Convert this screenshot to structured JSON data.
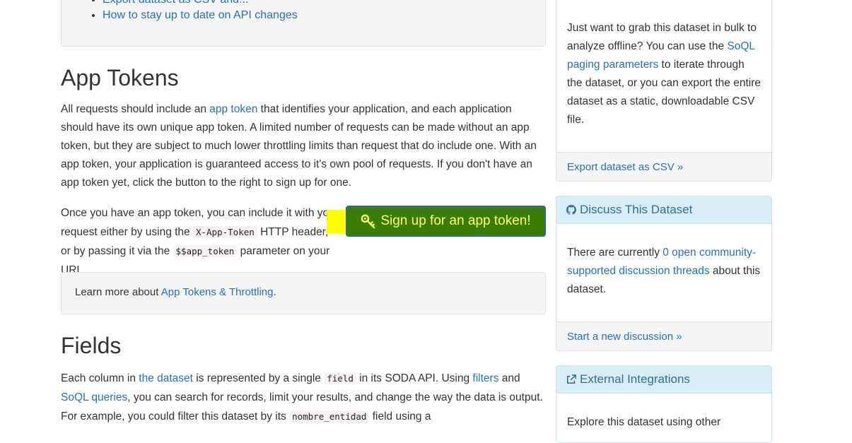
{
  "top_list": {
    "partial_item": "Export dataset as CSV and...",
    "item": "How to stay up to date on API changes"
  },
  "app_tokens": {
    "heading": "App Tokens",
    "p1": {
      "pre": "All requests should include an ",
      "link": "app token",
      "post": " that identifies your application, and each application should have its own unique app token. A limited number of requests can be made without an app token, but they are subject to much lower throttling limits than request that do include one. With an app token, your application is guaranteed access to it's own pool of requests. If you don't have an app token yet, click the button to the right to sign up for one."
    },
    "p2": {
      "pre": "Once you have an app token, you can include it with your request either by using the ",
      "code1": "X-App-Token",
      "mid": " HTTP header, or by passing it via the ",
      "code2": "$$app_token",
      "post": " parameter on your URL."
    },
    "signup_button": "Sign up for an app token!",
    "learn": {
      "pre": "Learn more about ",
      "link": "App Tokens & Throttling",
      "post": "."
    }
  },
  "fields": {
    "heading": "Fields",
    "p": {
      "t1": "Each column in ",
      "l1": "the dataset",
      "t2": " is represented by a single ",
      "c1": "field",
      "t3": " in its SODA API. Using ",
      "l2": "filters",
      "t4": " and ",
      "l3": "SoQL queries",
      "t5": ", you can search for records, limit your results, and change the way the data is output. For example, you could filter this dataset by its ",
      "c2": "nombre_entidad",
      "t6": " field using a"
    }
  },
  "sidebar": {
    "export_panel": {
      "t1": "Just want to grab this dataset in bulk to analyze offline? You can use the ",
      "link": "SoQL paging parameters",
      "t2": " to iterate through the dataset, or you can export the entire dataset as a static, downloadable CSV file.",
      "footer": "Export dataset as CSV »"
    },
    "discuss_panel": {
      "heading": "Discuss This Dataset",
      "t1": "There are currently ",
      "link": "0 open community-supported discussion threads",
      "t2": " about this dataset.",
      "footer": "Start a new discussion »"
    },
    "integrations_panel": {
      "heading": "External Integrations",
      "body": "Explore this dataset using other"
    }
  },
  "colors": {
    "link": "#2a6ebb",
    "button_bg": "#3a7d00",
    "button_text": "#ffff66",
    "highlight": "#ffff00",
    "panel_heading_bg": "#d9edf7"
  }
}
